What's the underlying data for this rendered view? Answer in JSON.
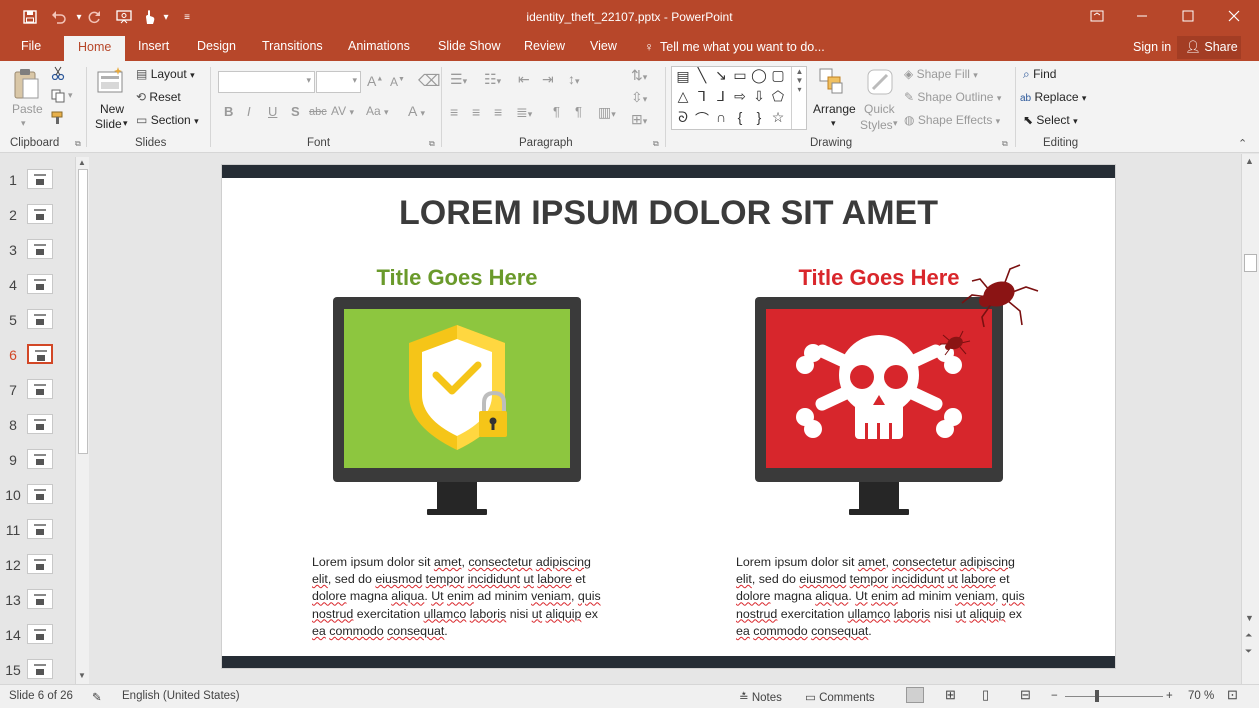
{
  "app": {
    "window_title": "identity_theft_22107.pptx - PowerPoint",
    "quick_access": {
      "save_icon": "save-icon",
      "undo_icon": "undo-icon",
      "redo_icon": "redo-icon",
      "presenter_icon": "presentation-icon",
      "touch_icon": "touch-mode-icon",
      "customize_icon": "customize-toolbar-icon"
    }
  },
  "tabs": [
    "File",
    "Home",
    "Insert",
    "Design",
    "Transitions",
    "Animations",
    "Slide Show",
    "Review",
    "View"
  ],
  "active_tab": "Home",
  "tell_me": "Tell me what you want to do...",
  "sign_in": "Sign in",
  "share": "Share",
  "ribbon": {
    "clipboard": {
      "label": "Clipboard",
      "paste": "Paste"
    },
    "slides": {
      "label": "Slides",
      "new_slide_1": "New",
      "new_slide_2": "Slide",
      "layout": "Layout",
      "reset": "Reset",
      "section": "Section"
    },
    "font": {
      "label": "Font",
      "bold": "B",
      "italic": "I",
      "underline": "U",
      "shadow": "S",
      "strike": "abc",
      "spacing": "AV",
      "case": "Aa",
      "color": "A"
    },
    "paragraph": {
      "label": "Paragraph"
    },
    "drawing": {
      "label": "Drawing",
      "arrange": "Arrange",
      "quick_styles_1": "Quick",
      "quick_styles_2": "Styles",
      "shape_fill": "Shape Fill",
      "shape_outline": "Shape Outline",
      "shape_effects": "Shape Effects"
    },
    "editing": {
      "label": "Editing",
      "find": "Find",
      "replace": "Replace",
      "select": "Select"
    }
  },
  "thumbnails": [
    {
      "num": "1"
    },
    {
      "num": "2"
    },
    {
      "num": "3"
    },
    {
      "num": "4"
    },
    {
      "num": "5"
    },
    {
      "num": "6"
    },
    {
      "num": "7"
    },
    {
      "num": "8"
    },
    {
      "num": "9"
    },
    {
      "num": "10"
    },
    {
      "num": "11"
    },
    {
      "num": "12"
    },
    {
      "num": "13"
    },
    {
      "num": "14"
    },
    {
      "num": "15"
    }
  ],
  "active_slide": "6",
  "slide": {
    "title": "LOREM IPSUM DOLOR SIT AMET",
    "left": {
      "title": "Title Goes Here",
      "title_color": "#6a9a2b",
      "screen_color": "#8dc63f",
      "icon": "shield-check-lock-icon",
      "text_parts": [
        [
          "Lorem ipsum dolor sit ",
          false
        ],
        [
          "amet",
          true
        ],
        [
          ", ",
          false
        ],
        [
          "consectetur",
          true
        ],
        [
          " ",
          false
        ],
        [
          "adipiscing",
          true
        ],
        [
          " ",
          false
        ],
        [
          "elit",
          true
        ],
        [
          ", sed do ",
          false
        ],
        [
          "eiusmod",
          true
        ],
        [
          " ",
          false
        ],
        [
          "tempor",
          true
        ],
        [
          " ",
          false
        ],
        [
          "incididunt",
          true
        ],
        [
          " ",
          false
        ],
        [
          "ut",
          true
        ],
        [
          " ",
          false
        ],
        [
          "labore",
          true
        ],
        [
          " et ",
          false
        ],
        [
          "dolore",
          true
        ],
        [
          " magna ",
          false
        ],
        [
          "aliqua",
          true
        ],
        [
          ". ",
          false
        ],
        [
          "Ut",
          true
        ],
        [
          " ",
          false
        ],
        [
          "enim",
          true
        ],
        [
          " ad minim ",
          false
        ],
        [
          "veniam",
          true
        ],
        [
          ", ",
          false
        ],
        [
          "quis",
          true
        ],
        [
          " ",
          false
        ],
        [
          "nostrud",
          true
        ],
        [
          " exercitation ",
          false
        ],
        [
          "ullamco",
          true
        ],
        [
          " ",
          false
        ],
        [
          "laboris",
          true
        ],
        [
          " nisi ",
          false
        ],
        [
          "ut",
          true
        ],
        [
          " ",
          false
        ],
        [
          "aliquip",
          true
        ],
        [
          " ex ",
          false
        ],
        [
          "ea",
          true
        ],
        [
          " ",
          false
        ],
        [
          "commodo",
          true
        ],
        [
          " ",
          false
        ],
        [
          "consequat",
          true
        ],
        [
          ".",
          false
        ]
      ]
    },
    "right": {
      "title": "Title Goes Here",
      "title_color": "#d9262b",
      "screen_color": "#d7262c",
      "icon": "skull-crossbones-icon",
      "bug_icon": "bug-icon",
      "text_parts": [
        [
          "Lorem ipsum dolor sit ",
          false
        ],
        [
          "amet",
          true
        ],
        [
          ", ",
          false
        ],
        [
          "consectetur",
          true
        ],
        [
          " ",
          false
        ],
        [
          "adipiscing",
          true
        ],
        [
          " ",
          false
        ],
        [
          "elit",
          true
        ],
        [
          ", sed do ",
          false
        ],
        [
          "eiusmod",
          true
        ],
        [
          " ",
          false
        ],
        [
          "tempor",
          true
        ],
        [
          " ",
          false
        ],
        [
          "incididunt",
          true
        ],
        [
          " ",
          false
        ],
        [
          "ut",
          true
        ],
        [
          " ",
          false
        ],
        [
          "labore",
          true
        ],
        [
          " et ",
          false
        ],
        [
          "dolore",
          true
        ],
        [
          " magna ",
          false
        ],
        [
          "aliqua",
          true
        ],
        [
          ". ",
          false
        ],
        [
          "Ut",
          true
        ],
        [
          " ",
          false
        ],
        [
          "enim",
          true
        ],
        [
          " ad minim ",
          false
        ],
        [
          "veniam",
          true
        ],
        [
          ", ",
          false
        ],
        [
          "quis",
          true
        ],
        [
          " ",
          false
        ],
        [
          "nostrud",
          true
        ],
        [
          " exercitation ",
          false
        ],
        [
          "ullamco",
          true
        ],
        [
          " ",
          false
        ],
        [
          "laboris",
          true
        ],
        [
          " nisi ",
          false
        ],
        [
          "ut",
          true
        ],
        [
          " ",
          false
        ],
        [
          "aliquip",
          true
        ],
        [
          " ex ",
          false
        ],
        [
          "ea",
          true
        ],
        [
          " ",
          false
        ],
        [
          "commodo",
          true
        ],
        [
          " ",
          false
        ],
        [
          "consequat",
          true
        ],
        [
          ".",
          false
        ]
      ]
    }
  },
  "status": {
    "slide_of": "Slide 6 of 26",
    "language": "English (United States)",
    "notes": "Notes",
    "comments": "Comments",
    "zoom": "70 %"
  }
}
